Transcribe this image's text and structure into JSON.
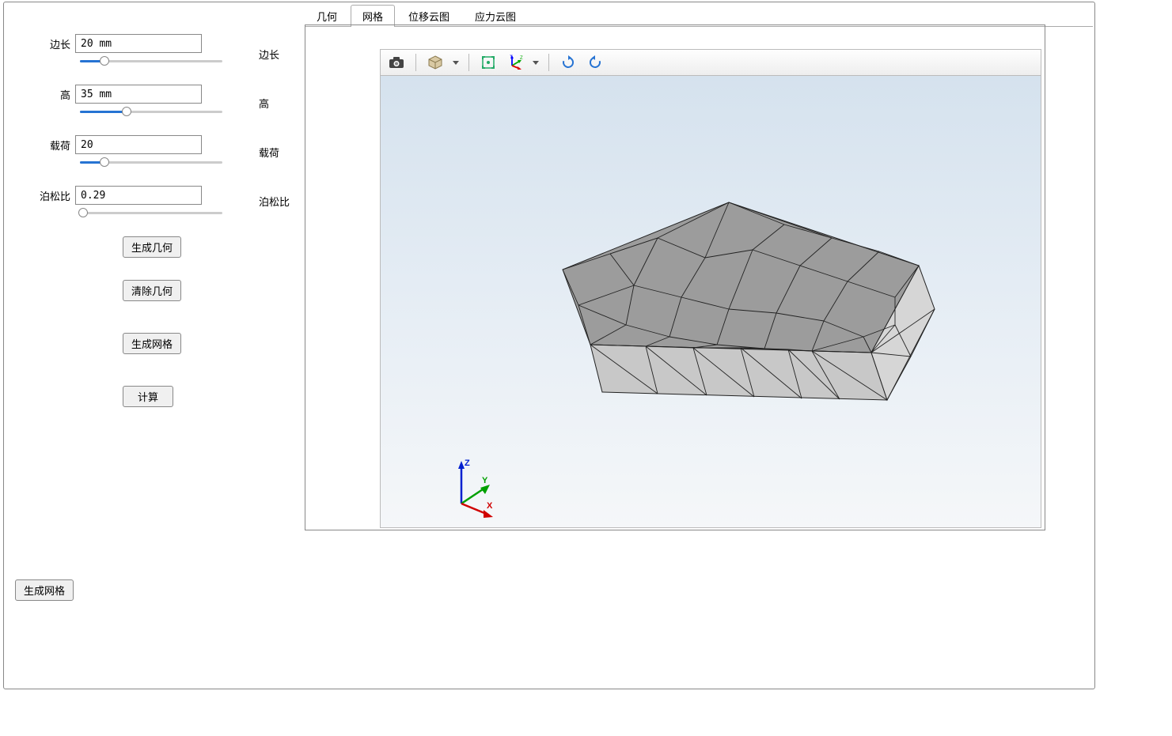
{
  "params": {
    "edge_length": {
      "label": "边长",
      "value": "20 mm",
      "slider_pct": 17,
      "echo": "边长"
    },
    "height": {
      "label": "高",
      "value": "35 mm",
      "slider_pct": 33,
      "echo": "高"
    },
    "load": {
      "label": "载荷",
      "value": "20",
      "slider_pct": 17,
      "echo": "载荷"
    },
    "poisson": {
      "label": "泊松比",
      "value": "0.29",
      "slider_pct": 2,
      "echo": "泊松比"
    }
  },
  "buttons": {
    "gen_geom": "生成几何",
    "clear_geom": "清除几何",
    "gen_mesh": "生成网格",
    "compute": "计算",
    "footer_gen_mesh": "生成网格"
  },
  "tabs": {
    "geom": "几何",
    "mesh": "网格",
    "disp_contour": "位移云图",
    "stress_contour": "应力云图",
    "active": "mesh"
  },
  "axis_labels": {
    "x": "X",
    "y": "Y",
    "z": "Z"
  },
  "toolbar_icons": [
    "camera",
    "cube-view",
    "fit-all",
    "axes",
    "rotate-cw",
    "rotate-ccw"
  ]
}
